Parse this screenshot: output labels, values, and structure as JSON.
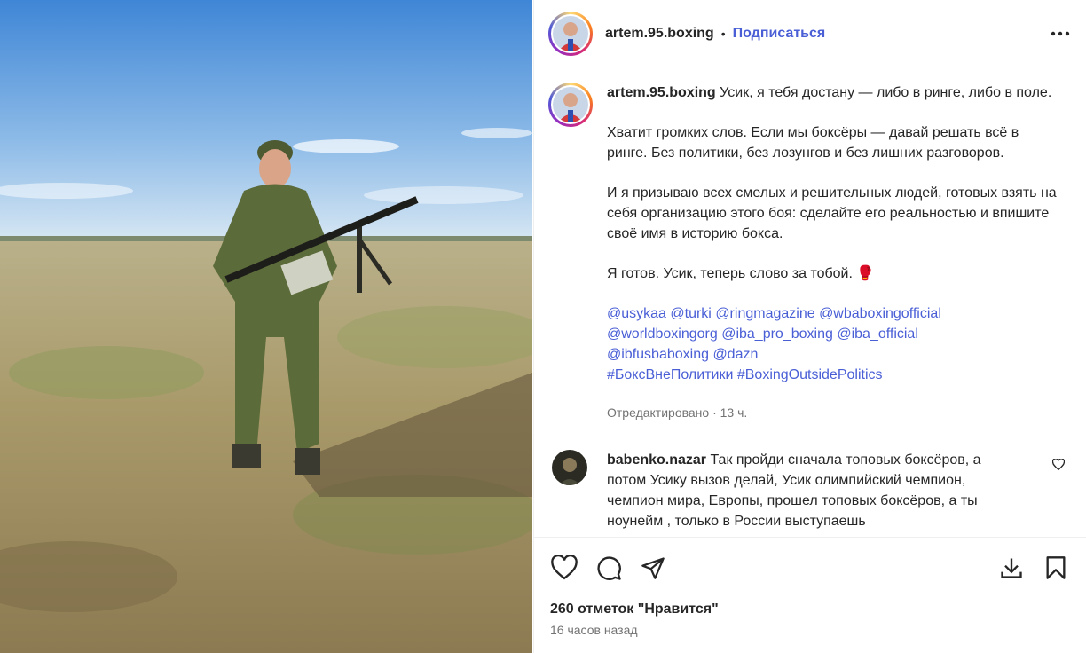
{
  "post": {
    "username": "artem.95.boxing",
    "dot": "•",
    "follow_label": "Подписаться",
    "caption": {
      "username": "artem.95.boxing",
      "p1": "Усик, я тебя достану — либо в ринге, либо в поле.",
      "p2": "Хватит громких слов. Если мы боксёры — давай решать всё в ринге. Без политики, без лозунгов и без лишних разговоров.",
      "p3": "И я призываю всех смелых и решительных людей, готовых взять на себя организацию этого боя: сделайте его реальностью и впишите своё имя в историю бокса.",
      "p4": "Я готов. Усик, теперь слово за тобой. 🥊",
      "tags": [
        "@usykaa",
        "@turki",
        "@ringmagazine",
        "@wbaboxingofficial",
        "@worldboxingorg",
        "@iba_pro_boxing",
        "@iba_official",
        "@ibfusbaboxing",
        "@dazn",
        "#БоксВнеПолитики",
        "#BoxingOutsidePolitics"
      ]
    },
    "edited_meta": "Отредактировано · 13 ч.",
    "comment": {
      "username": "babenko.nazar",
      "text": "Так пройди сначала топовых боксёров, а потом Усику вызов делай, Усик олимпийский чемпион, чемпион мира, Европы, прошел топовых боксёров, а ты ноунейм , только в России выступаешь"
    },
    "likes_label": "260 отметок \"Нравится\"",
    "time_label": "16 часов назад"
  },
  "icons": {
    "more": "more-options-icon",
    "like": "heart-icon",
    "comment": "comment-icon",
    "share": "share-icon",
    "download": "download-icon",
    "save": "bookmark-icon"
  },
  "colors": {
    "link": "#4a5fd6",
    "muted": "#737373",
    "text": "#262626"
  }
}
